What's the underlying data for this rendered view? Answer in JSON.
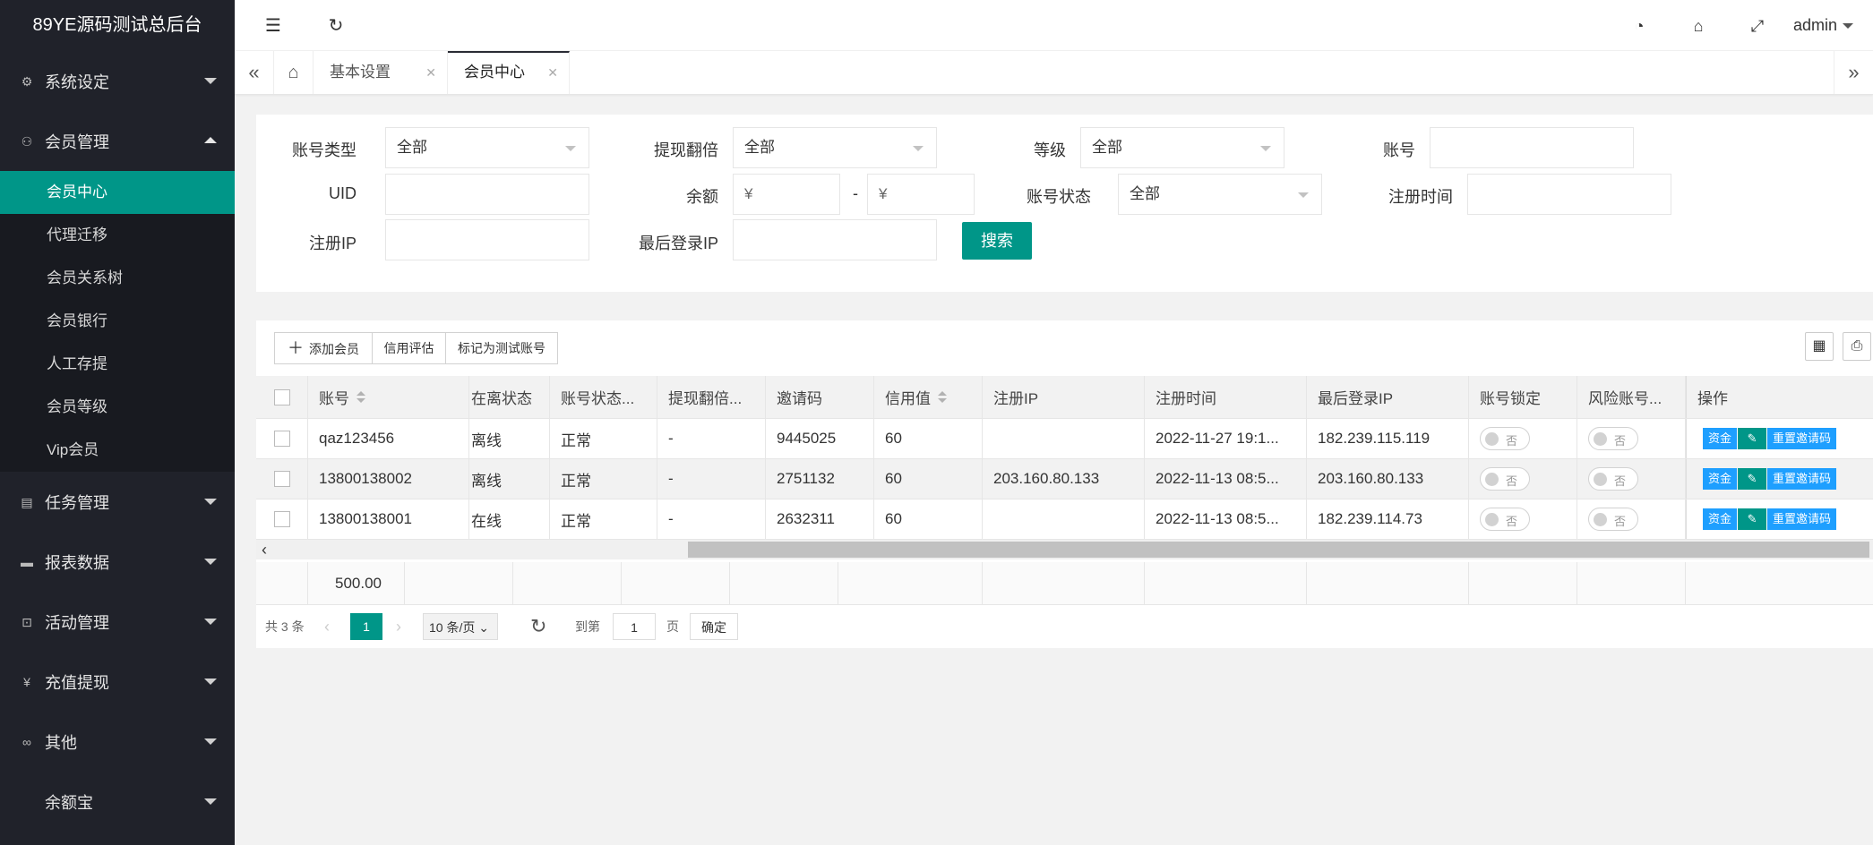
{
  "app": {
    "title": "89YE源码测试总后台"
  },
  "sidebar": {
    "menus": [
      {
        "label": "系统设定",
        "icon": "gear-icon"
      },
      {
        "label": "会员管理",
        "icon": "user-icon"
      },
      {
        "label": "任务管理",
        "icon": "document-icon"
      },
      {
        "label": "报表数据",
        "icon": "chart-icon"
      },
      {
        "label": "活动管理",
        "icon": "bus-icon"
      },
      {
        "label": "充值提现",
        "icon": "yen-icon"
      },
      {
        "label": "其他",
        "icon": "link-icon"
      },
      {
        "label": "余额宝",
        "icon": ""
      }
    ],
    "submenu": [
      "会员中心",
      "代理迁移",
      "会员关系树",
      "会员银行",
      "人工存提",
      "会员等级",
      "Vip会员"
    ]
  },
  "topbar": {
    "user": "admin"
  },
  "tabs": [
    {
      "label": "基本设置"
    },
    {
      "label": "会员中心"
    }
  ],
  "filters": {
    "account_type": {
      "label": "账号类型",
      "value": "全部"
    },
    "withdraw_multiple": {
      "label": "提现翻倍",
      "value": "全部"
    },
    "level": {
      "label": "等级",
      "value": "全部"
    },
    "account": {
      "label": "账号",
      "value": ""
    },
    "uid": {
      "label": "UID",
      "value": ""
    },
    "balance": {
      "label": "余额",
      "min_placeholder": "¥",
      "max_placeholder": "¥",
      "sep": "-"
    },
    "account_status": {
      "label": "账号状态",
      "value": "全部"
    },
    "register_time": {
      "label": "注册时间",
      "value": ""
    },
    "register_ip": {
      "label": "注册IP",
      "value": ""
    },
    "last_login_ip": {
      "label": "最后登录IP",
      "value": ""
    },
    "search_label": "搜索"
  },
  "toolbar": {
    "add_member": "添加会员",
    "credit_eval": "信用评估",
    "mark_test": "标记为测试账号"
  },
  "table": {
    "headers": [
      "账号",
      "在离状态",
      "账号状态...",
      "提现翻倍...",
      "邀请码",
      "信用值",
      "注册IP",
      "注册时间",
      "最后登录IP",
      "账号锁定",
      "风险账号...",
      "操作"
    ],
    "rows": [
      {
        "account": "qaz123456",
        "online": "离线",
        "status": "正常",
        "withdraw": "-",
        "invite": "9445025",
        "credit": "60",
        "reg_ip": "",
        "reg_time": "2022-11-27 19:1...",
        "last_ip": "182.239.115.119",
        "lock": "否",
        "risk": "否"
      },
      {
        "account": "13800138002",
        "online": "离线",
        "status": "正常",
        "withdraw": "-",
        "invite": "2751132",
        "credit": "60",
        "reg_ip": "203.160.80.133",
        "reg_time": "2022-11-13 08:5...",
        "last_ip": "203.160.80.133",
        "lock": "否",
        "risk": "否"
      },
      {
        "account": "13800138001",
        "online": "在线",
        "status": "正常",
        "withdraw": "-",
        "invite": "2632311",
        "credit": "60",
        "reg_ip": "",
        "reg_time": "2022-11-13 08:5...",
        "last_ip": "182.239.114.73",
        "lock": "否",
        "risk": "否"
      }
    ],
    "ops": {
      "funds": "资金",
      "reset_invite": "重置邀请码"
    },
    "total": "500.00"
  },
  "pager": {
    "total": "共 3 条",
    "current": "1",
    "page_size": "10 条/页",
    "goto_label": "到第",
    "goto_value": "1",
    "page_unit": "页",
    "confirm": "确定"
  }
}
